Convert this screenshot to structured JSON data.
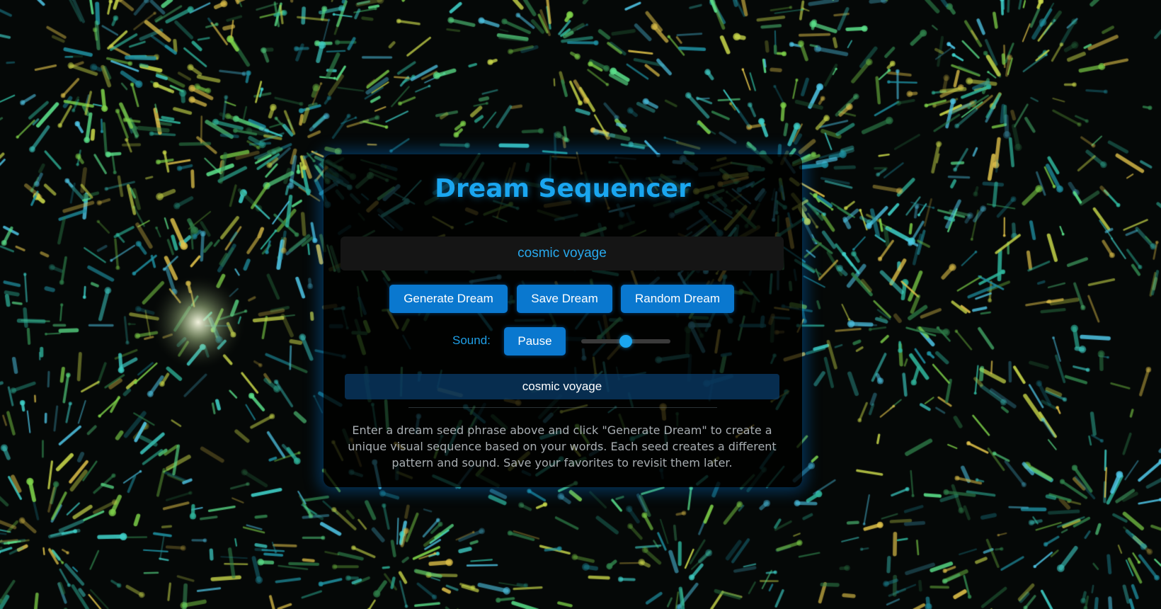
{
  "app": {
    "title": "Dream Sequencer"
  },
  "seed": {
    "value": "cosmic voyage"
  },
  "buttons": {
    "generate": "Generate Dream",
    "save": "Save Dream",
    "random": "Random Dream",
    "pause": "Pause"
  },
  "sound": {
    "label": "Sound:",
    "volume": 0.5
  },
  "current_dream": "cosmic voyage",
  "instructions": "Enter a dream seed phrase above and click \"Generate Dream\" to create a unique visual sequence based on your words. Each seed creates a different pattern and sound. Save your favorites to revisit them later.",
  "colors": {
    "accent": "#1aa6f0",
    "button": "#0a78cf",
    "panel_glow": "#008cff"
  }
}
